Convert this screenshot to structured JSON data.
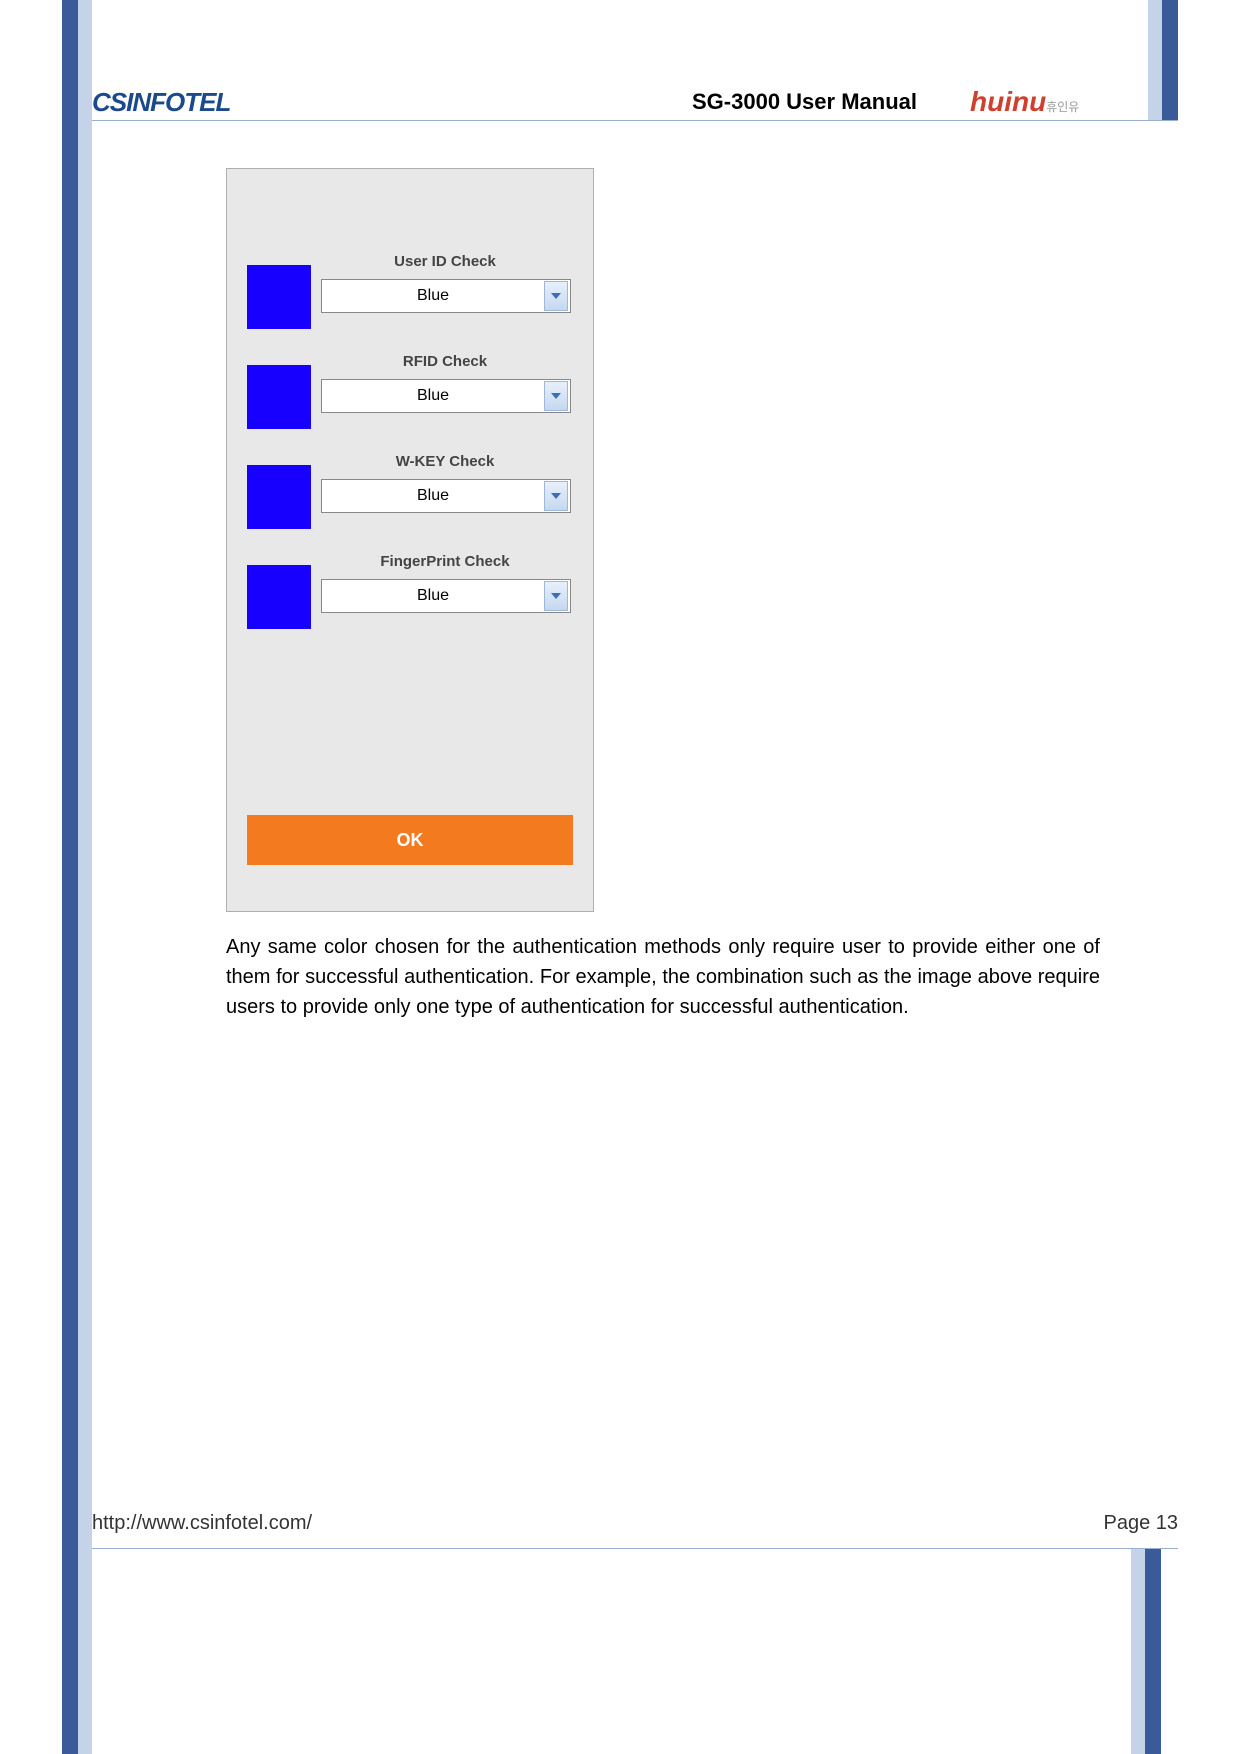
{
  "header": {
    "logo_left_cs": "CS",
    "logo_left_rest": "INFOTEL",
    "title": "SG-3000 User Manual",
    "logo_right_main": "huinu",
    "logo_right_suffix": "휴인유"
  },
  "app": {
    "groups": [
      {
        "label": "User ID Check",
        "value": "Blue",
        "swatch": "#1800FF"
      },
      {
        "label": "RFID Check",
        "value": "Blue",
        "swatch": "#1800FF"
      },
      {
        "label": "W-KEY Check",
        "value": "Blue",
        "swatch": "#1800FF"
      },
      {
        "label": "FingerPrint Check",
        "value": "Blue",
        "swatch": "#1800FF"
      }
    ],
    "ok_label": "OK"
  },
  "body_text": "Any same color chosen for the authentication methods only require user to provide either one of them for successful authentication. For example, the combination such as the image above require users to provide only one type of authentication for successful authentication.",
  "footer": {
    "url": "http://www.csinfotel.com/",
    "page_label": "Page ",
    "page_number": "13"
  }
}
